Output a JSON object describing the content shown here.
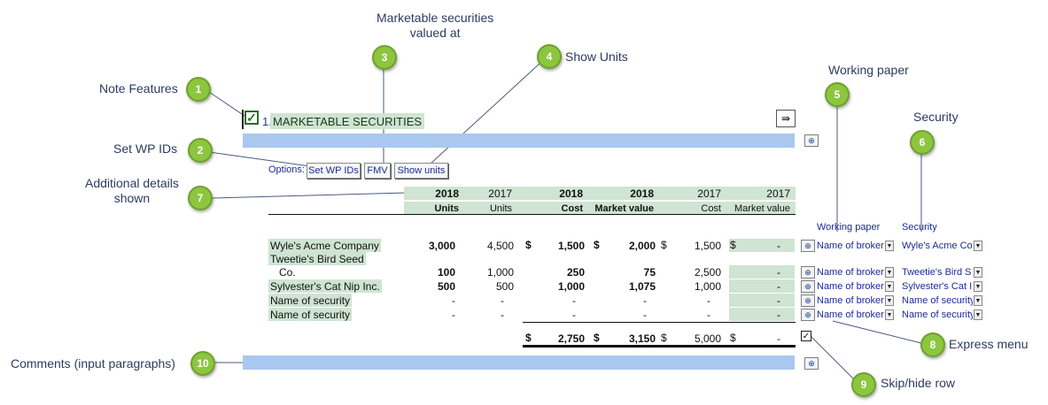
{
  "callouts": [
    {
      "num": "1",
      "label": "Note Features"
    },
    {
      "num": "2",
      "label": "Set WP IDs"
    },
    {
      "num": "3",
      "label": "Marketable securities\nvalued at"
    },
    {
      "num": "4",
      "label": "Show Units"
    },
    {
      "num": "5",
      "label": "Working paper"
    },
    {
      "num": "6",
      "label": "Security"
    },
    {
      "num": "7",
      "label": "Additional details\nshown"
    },
    {
      "num": "8",
      "label": "Express menu"
    },
    {
      "num": "9",
      "label": "Skip/hide row"
    },
    {
      "num": "10",
      "label": "Comments (input paragraphs)"
    }
  ],
  "note": {
    "number": "1.",
    "title": "MARKETABLE SECURITIES"
  },
  "options": {
    "label": "Options:",
    "set_wp_ids": "Set WP IDs",
    "fmv": "FMV",
    "show_units": "Show units"
  },
  "table": {
    "header_years": [
      "2018",
      "2017",
      "2018",
      "2018",
      "2017",
      "2017"
    ],
    "header_labels": [
      "Units",
      "Units",
      "Cost",
      "Market value",
      "Cost",
      "Market value"
    ],
    "wp_column_title": "Working paper",
    "security_column_title": "Security",
    "rows": [
      {
        "name": "Wyle's Acme Company",
        "units18": "3,000",
        "units17": "4,500",
        "cost18": "1,500",
        "mv18": "2,000",
        "cost17": "1,500",
        "mv17": "-",
        "wp": "Name of broker",
        "security": "Wyle's Acme Co"
      },
      {
        "name": "Tweetie's Bird Seed",
        "name2": "Co.",
        "units18": "100",
        "units17": "1,000",
        "cost18": "250",
        "mv18": "75",
        "cost17": "2,500",
        "mv17": "-",
        "wp": "Name of broker",
        "security": "Tweetie's Bird S"
      },
      {
        "name": "Sylvester's Cat Nip Inc.",
        "units18": "500",
        "units17": "500",
        "cost18": "1,000",
        "mv18": "1,075",
        "cost17": "1,000",
        "mv17": "-",
        "wp": "Name of broker",
        "security": "Sylvester's Cat I"
      },
      {
        "name": "Name of security",
        "units18": "-",
        "units17": "-",
        "cost18": "-",
        "mv18": "-",
        "cost17": "-",
        "mv17": "-",
        "wp": "Name of broker",
        "security": "Name of security"
      },
      {
        "name": "Name of security",
        "units18": "-",
        "units17": "-",
        "cost18": "-",
        "mv18": "-",
        "cost17": "-",
        "mv17": "-",
        "wp": "Name of broker",
        "security": "Name of security"
      }
    ],
    "totals": {
      "currency": "$",
      "cost18": "2,750",
      "mv18": "3,150",
      "cost17": "5,000",
      "mv17": "-"
    }
  }
}
